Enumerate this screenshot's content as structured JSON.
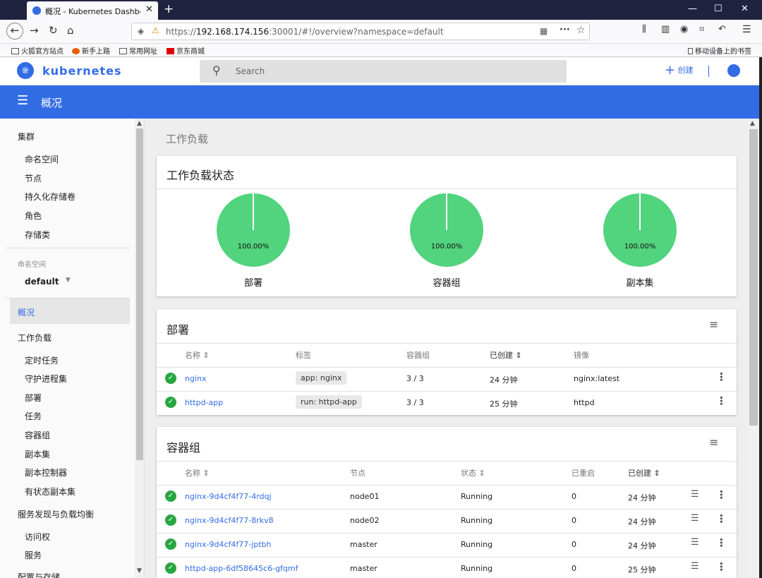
{
  "browser": {
    "tab_title": "概况 - Kubernetes Dashboard",
    "url_prefix": "https://",
    "url_host": "192.168.174.156",
    "url_rest": ":30001/#!/overview?namespace=default",
    "bookmarks": [
      "火狐官方站点",
      "新手上路",
      "常用网址",
      "京东商城"
    ],
    "mobile_bookmarks": "移动设备上的书签"
  },
  "header": {
    "brand": "kubernetes",
    "search_placeholder": "Search",
    "create_label": "创建",
    "page_title": "概况"
  },
  "sidebar": {
    "cluster_heading": "集群",
    "cluster_items": [
      "命名空间",
      "节点",
      "持久化存储卷",
      "角色",
      "存储类"
    ],
    "namespace_label": "命名空间",
    "namespace_value": "default",
    "overview": "概况",
    "workloads_heading": "工作负载",
    "workload_items": [
      "定时任务",
      "守护进程集",
      "部署",
      "任务",
      "容器组",
      "副本集",
      "副本控制器",
      "有状态副本集"
    ],
    "discovery_heading": "服务发现与负载均衡",
    "discovery_items": [
      "访问权",
      "服务"
    ],
    "config_heading": "配置与存储"
  },
  "main": {
    "section_title": "工作负载",
    "status_card": {
      "title": "工作负载状态",
      "pies": [
        {
          "label": "部署",
          "percent": "100.00%"
        },
        {
          "label": "容器组",
          "percent": "100.00%"
        },
        {
          "label": "副本集",
          "percent": "100.00%"
        }
      ]
    },
    "deployments": {
      "title": "部署",
      "columns": [
        "名称",
        "标签",
        "容器组",
        "已创建",
        "镜像"
      ],
      "rows": [
        {
          "name": "nginx",
          "label": "app: nginx",
          "pods": "3 / 3",
          "created": "24 分钟",
          "image": "nginx:latest"
        },
        {
          "name": "httpd-app",
          "label": "run: httpd-app",
          "pods": "3 / 3",
          "created": "25 分钟",
          "image": "httpd"
        }
      ]
    },
    "pods": {
      "title": "容器组",
      "columns": [
        "名称",
        "节点",
        "状态",
        "已重启",
        "已创建"
      ],
      "rows": [
        {
          "name": "nginx-9d4cf4f77-4rdqj",
          "node": "node01",
          "status": "Running",
          "restarts": "0",
          "created": "24 分钟"
        },
        {
          "name": "nginx-9d4cf4f77-8rkv8",
          "node": "node02",
          "status": "Running",
          "restarts": "0",
          "created": "24 分钟"
        },
        {
          "name": "nginx-9d4cf4f77-jptbh",
          "node": "master",
          "status": "Running",
          "restarts": "0",
          "created": "24 分钟"
        },
        {
          "name": "httpd-app-6df58645c6-gfqmf",
          "node": "master",
          "status": "Running",
          "restarts": "0",
          "created": "25 分钟"
        }
      ]
    }
  },
  "colors": {
    "accent": "#326ce5",
    "pie": "#52d37e",
    "ok": "#26a641"
  }
}
